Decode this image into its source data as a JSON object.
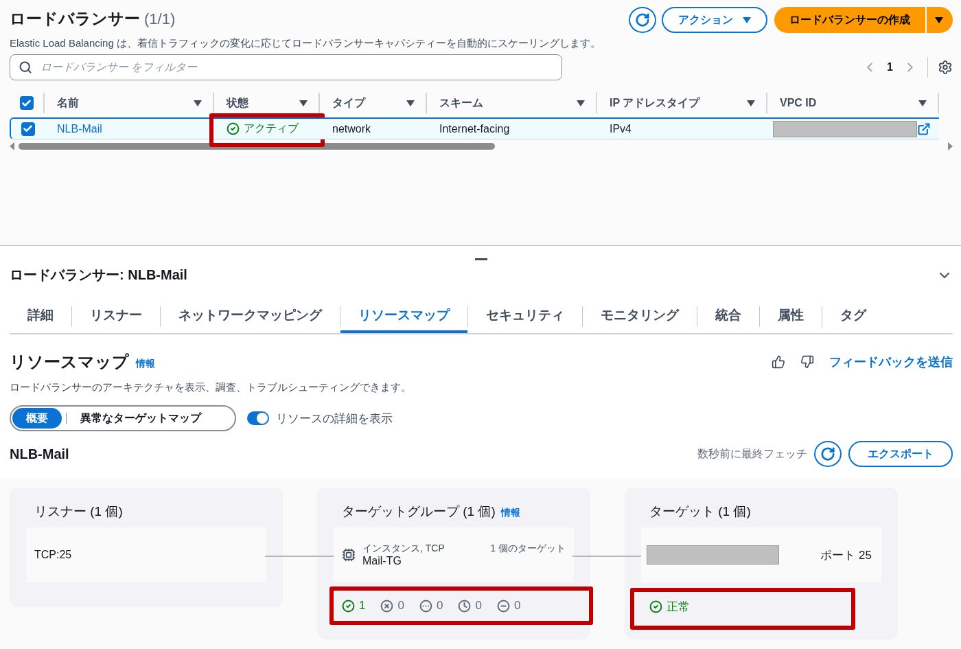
{
  "header": {
    "title": "ロードバランサー",
    "count": "(1/1)",
    "description": "Elastic Load Balancing は、着信トラフィックの変化に応じてロードバランサーキャパシティーを自動的にスケーリングします。",
    "actions_button": "アクション",
    "create_button": "ロードバランサーの作成"
  },
  "filter": {
    "placeholder": "ロードバランサー をフィルター"
  },
  "pagination": {
    "page": "1"
  },
  "table": {
    "all_checked": true,
    "columns": [
      "名前",
      "状態",
      "タイプ",
      "スキーム",
      "IP アドレスタイプ",
      "VPC ID"
    ],
    "rows": [
      {
        "checked": true,
        "name": "NLB-Mail",
        "status": "アクティブ",
        "status_highlighted": true,
        "type": "network",
        "scheme": "Internet-facing",
        "ip_type": "IPv4"
      }
    ]
  },
  "details": {
    "title": "ロードバランサー: NLB-Mail",
    "tabs": [
      {
        "label": "詳細",
        "selected": false
      },
      {
        "label": "リスナー",
        "selected": false
      },
      {
        "label": "ネットワークマッピング",
        "selected": false
      },
      {
        "label": "リソースマップ",
        "selected": true
      },
      {
        "label": "セキュリティ",
        "selected": false
      },
      {
        "label": "モニタリング",
        "selected": false
      },
      {
        "label": "統合",
        "selected": false
      },
      {
        "label": "属性",
        "selected": false
      },
      {
        "label": "タグ",
        "selected": false
      }
    ],
    "section_title": "リソースマップ",
    "info": "情報",
    "description": "ロードバランサーのアーキテクチャを表示、調査、トラブルシューティングできます。",
    "feedback": "フィードバックを送信",
    "view_toggle": [
      {
        "label": "概要",
        "selected": true
      },
      {
        "label": "異常なターゲットマップ",
        "selected": false
      }
    ],
    "details_switch": {
      "label": "リソースの詳細を表示",
      "on": true
    },
    "map_title": "NLB-Mail",
    "fetch_note": "数秒前に最終フェッチ",
    "export_button": "エクスポート"
  },
  "map": {
    "listeners": {
      "title": "リスナー (1 個)",
      "items": [
        "TCP:25"
      ]
    },
    "target_groups": {
      "title": "ターゲットグループ (1 個)",
      "info": "情報",
      "type": "インスタンス, TCP",
      "name": "Mail-TG",
      "targets": "1 個のターゲット",
      "highlighted": true,
      "counts": [
        {
          "kind": "healthy",
          "value": "1"
        },
        {
          "kind": "unhealthy",
          "value": "0"
        },
        {
          "kind": "unused",
          "value": "0"
        },
        {
          "kind": "draining",
          "value": "0"
        },
        {
          "kind": "unavailable",
          "value": "0"
        }
      ]
    },
    "targets": {
      "title": "ターゲット (1 個)",
      "port": "ポート 25",
      "status": "正常",
      "highlighted": true
    }
  }
}
